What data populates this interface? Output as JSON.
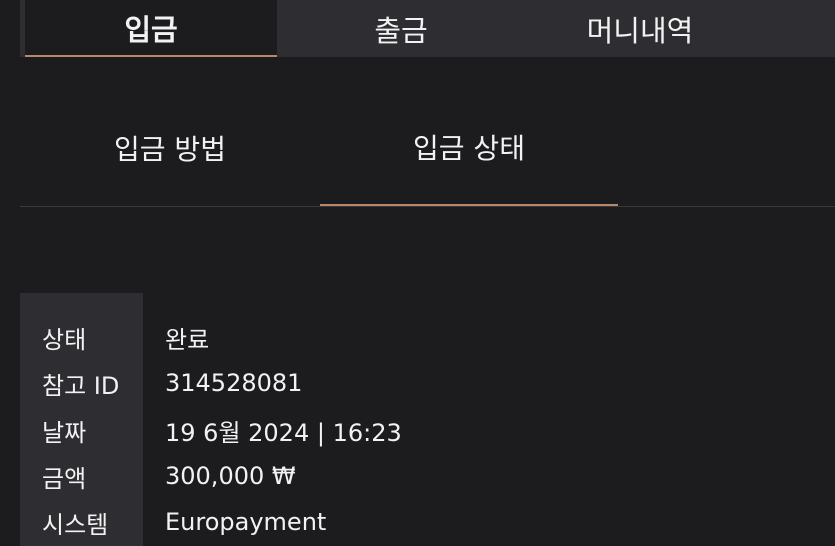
{
  "top_tabs": [
    {
      "label": "입금",
      "active": true
    },
    {
      "label": "출금",
      "active": false
    },
    {
      "label": "머니내역",
      "active": false
    }
  ],
  "sub_tabs": [
    {
      "label": "입금 방법",
      "active": false
    },
    {
      "label": "입금 상태",
      "active": true
    }
  ],
  "details": [
    {
      "label": "상태",
      "value": "완료"
    },
    {
      "label": "참고 ID",
      "value": "314528081"
    },
    {
      "label": "날짜",
      "value": "19 6월 2024 | 16:23"
    },
    {
      "label": "금액",
      "value": "300,000 ₩"
    },
    {
      "label": "시스템",
      "value": "Europayment"
    }
  ],
  "colors": {
    "background": "#1c1b1e",
    "panel": "#2e2d31",
    "accent": "#b9876a",
    "text": "#f2f2f2"
  }
}
